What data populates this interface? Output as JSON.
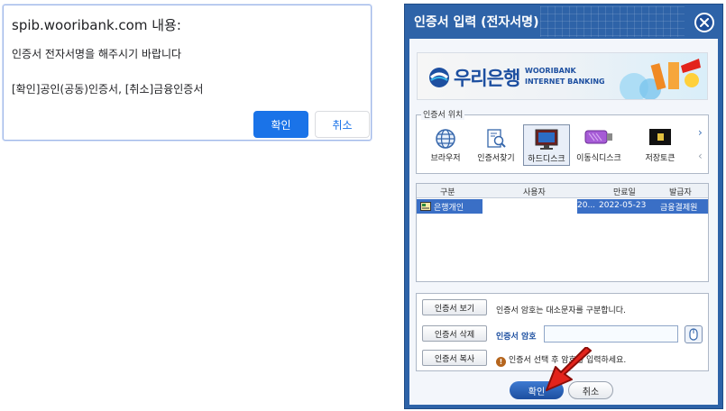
{
  "confirm_dialog": {
    "origin": "spib.wooribank.com 내용:",
    "message_line1": "인증서 전자서명을 해주시기 바랍니다",
    "message_line2": "[확인]공인(공동)인증서, [취소]금융인증서",
    "ok_label": "확인",
    "cancel_label": "취소"
  },
  "cert_window": {
    "title": "인증서 입력 (전자서명)",
    "banner": {
      "logo_text": "우리은행",
      "logo_sub1": "WOORIBANK",
      "logo_sub2": "INTERNET BANKING"
    },
    "location": {
      "legend": "인증서 위치",
      "items": [
        {
          "label": "브라우저",
          "icon": "globe-icon"
        },
        {
          "label": "인증서찾기",
          "icon": "cert-search-icon"
        },
        {
          "label": "하드디스크",
          "icon": "hard-disk-icon",
          "selected": true
        },
        {
          "label": "이동식디스크",
          "icon": "usb-drive-icon"
        },
        {
          "label": "저장토큰",
          "icon": "security-token-icon"
        }
      ],
      "next_arrow": "›",
      "prev_arrow": "‹"
    },
    "table": {
      "headers": [
        "구분",
        "사용자",
        "만료일",
        "발급자"
      ],
      "row": {
        "type": "은행개인",
        "user_partial": "20...",
        "expiry": "2022-05-23",
        "issuer": "금융결제원"
      }
    },
    "buttons": {
      "view": "인증서 보기",
      "delete": "인증서 삭제",
      "copy": "인증서 복사",
      "ok": "확인",
      "cancel": "취소"
    },
    "hint": "인증서 암호는 대소문자를 구분합니다.",
    "password_label": "인증서 암호",
    "warning": "인증서 선택 후 암호를 입력하세요."
  },
  "colors": {
    "accent_blue": "#1a73e8",
    "window_blue": "#2e63a8",
    "selection_blue": "#3a6fc6",
    "annotation_red": "#e3231b"
  }
}
